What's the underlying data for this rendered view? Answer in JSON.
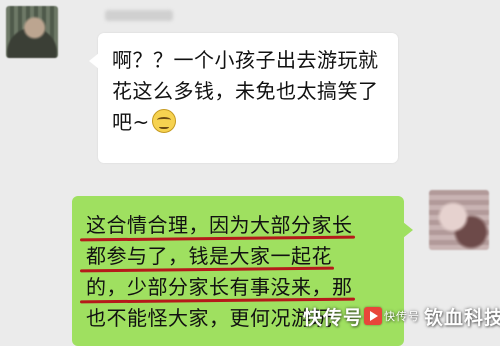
{
  "chat": {
    "sender_name": "blurred-name",
    "received_message": {
      "lines": [
        "啊？？一个小孩子出去游玩就",
        "花这么多钱，未免也太搞笑了",
        "吧~"
      ],
      "emoji": "smirk-emoji"
    },
    "sent_message": {
      "lines": [
        "这合情合理，因为大部分家长",
        "都参与了，钱是大家一起花",
        "的，少部分家长有事没来，那",
        "也不能怪大家，更何况游玩"
      ]
    }
  },
  "watermark": {
    "text_left": "快传号",
    "text_small": "快传号",
    "text_right": "钦血科技"
  },
  "colors": {
    "background": "#ebebeb",
    "received_bubble": "#ffffff",
    "sent_bubble": "#9fe060",
    "underline": "#b51a1a"
  }
}
